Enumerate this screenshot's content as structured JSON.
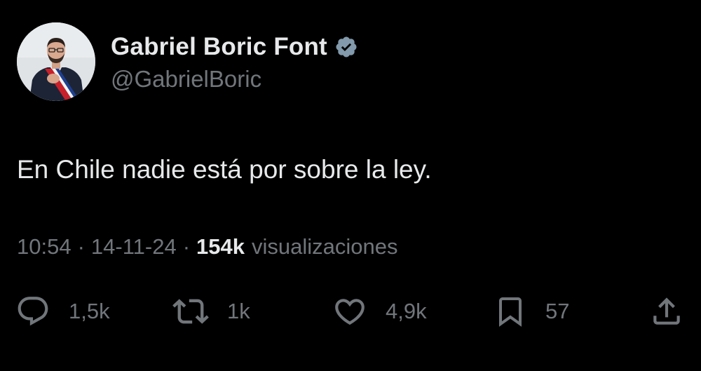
{
  "author": {
    "display_name": "Gabriel Boric Font",
    "handle": "@GabrielBoric",
    "verified": true,
    "verified_icon": "verified-badge-icon",
    "avatar_icon": "avatar"
  },
  "tweet": {
    "text": "En Chile nadie está por sobre la ley."
  },
  "meta": {
    "time": "10:54",
    "separator": "·",
    "date": "14-11-24",
    "views_count": "154k",
    "views_label": "visualizaciones"
  },
  "actions": {
    "reply": {
      "icon": "reply-icon",
      "count": "1,5k"
    },
    "retweet": {
      "icon": "retweet-icon",
      "count": "1k"
    },
    "like": {
      "icon": "heart-icon",
      "count": "4,9k"
    },
    "bookmark": {
      "icon": "bookmark-icon",
      "count": "57"
    },
    "share": {
      "icon": "share-icon"
    }
  },
  "colors": {
    "background": "#000000",
    "primary_text": "#e7e9ea",
    "secondary_text": "#71767b",
    "verified_badge": "#829aab"
  }
}
